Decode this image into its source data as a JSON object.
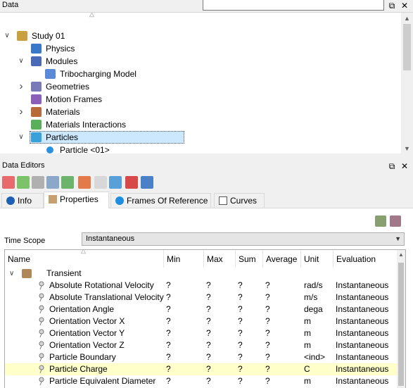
{
  "data_panel": {
    "title": "Data",
    "search_value": "",
    "tree": [
      {
        "label": "Study 01",
        "icon": "study-icon",
        "expander": "expanded"
      },
      {
        "label": "Physics",
        "icon": "physics-icon",
        "expander": "none"
      },
      {
        "label": "Modules",
        "icon": "modules-icon",
        "expander": "expanded"
      },
      {
        "label": "Tribocharging Model",
        "icon": "document-icon",
        "expander": "none"
      },
      {
        "label": "Geometries",
        "icon": "geometries-icon",
        "expander": "collapsed"
      },
      {
        "label": "Motion Frames",
        "icon": "motion-frames-icon",
        "expander": "none"
      },
      {
        "label": "Materials",
        "icon": "materials-icon",
        "expander": "collapsed"
      },
      {
        "label": "Materials Interactions",
        "icon": "materials-interactions-icon",
        "expander": "none"
      },
      {
        "label": "Particles",
        "icon": "particles-icon",
        "expander": "expanded",
        "selected": true
      },
      {
        "label": "Particle <01>",
        "icon": "particle-dot-icon",
        "expander": "none"
      }
    ]
  },
  "editors_panel": {
    "title": "Data Editors",
    "tabs": [
      {
        "label": "Info",
        "icon": "info-icon"
      },
      {
        "label": "Properties",
        "icon": "properties-icon",
        "active": true
      },
      {
        "label": "Frames Of Reference",
        "icon": "frames-icon"
      },
      {
        "label": "Curves",
        "icon": "curves-icon"
      }
    ],
    "time_scope_label": "Time Scope",
    "time_scope_value": "Instantaneous",
    "columns": [
      "Name",
      "Min",
      "Max",
      "Sum",
      "Average",
      "Unit",
      "Evaluation"
    ],
    "group": "Transient",
    "rows": [
      {
        "name": "Absolute Rotational Velocity",
        "min": "?",
        "max": "?",
        "sum": "?",
        "average": "?",
        "unit": "rad/s",
        "evaluation": "Instantaneous"
      },
      {
        "name": "Absolute Translational Velocity",
        "min": "?",
        "max": "?",
        "sum": "?",
        "average": "?",
        "unit": "m/s",
        "evaluation": "Instantaneous"
      },
      {
        "name": "Orientation Angle",
        "min": "?",
        "max": "?",
        "sum": "?",
        "average": "?",
        "unit": "dega",
        "evaluation": "Instantaneous"
      },
      {
        "name": "Orientation Vector X",
        "min": "?",
        "max": "?",
        "sum": "?",
        "average": "?",
        "unit": "m",
        "evaluation": "Instantaneous"
      },
      {
        "name": "Orientation Vector Y",
        "min": "?",
        "max": "?",
        "sum": "?",
        "average": "?",
        "unit": "m",
        "evaluation": "Instantaneous"
      },
      {
        "name": "Orientation Vector Z",
        "min": "?",
        "max": "?",
        "sum": "?",
        "average": "?",
        "unit": "m",
        "evaluation": "Instantaneous"
      },
      {
        "name": "Particle Boundary",
        "min": "?",
        "max": "?",
        "sum": "?",
        "average": "?",
        "unit": "<ind>",
        "evaluation": "Instantaneous"
      },
      {
        "name": "Particle Charge",
        "min": "?",
        "max": "?",
        "sum": "?",
        "average": "?",
        "unit": "C",
        "evaluation": "Instantaneous",
        "highlighted": true
      },
      {
        "name": "Particle Equivalent Diameter",
        "min": "?",
        "max": "?",
        "sum": "?",
        "average": "?",
        "unit": "m",
        "evaluation": "Instantaneous"
      }
    ]
  },
  "colors": {
    "selection": "#cce8ff",
    "highlight_row": "#ffffc9",
    "panel_bg": "#f0f0f0"
  }
}
